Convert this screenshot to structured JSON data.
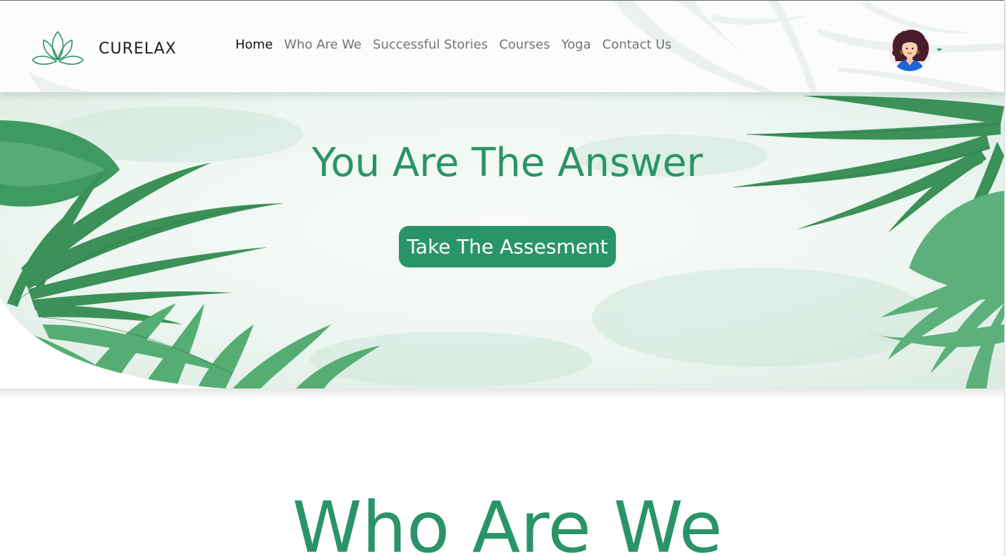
{
  "brand": {
    "name": "CURELAX",
    "accent_color": "#2a9469",
    "logo_icon": "lotus-icon"
  },
  "nav": {
    "links": [
      {
        "label": "Home",
        "active": true
      },
      {
        "label": "Who Are We",
        "active": false
      },
      {
        "label": "Successful Stories",
        "active": false
      },
      {
        "label": "Courses",
        "active": false
      },
      {
        "label": "Yoga",
        "active": false
      },
      {
        "label": "Contact Us",
        "active": false
      }
    ]
  },
  "profile": {
    "avatar_icon": "user-avatar-icon",
    "menu_icon": "caret-down-icon"
  },
  "hero": {
    "title": "You Are The Answer",
    "cta_label": "Take The Assesment",
    "decoration": "palm-leaves-illustration"
  },
  "about": {
    "title": "Who Are We"
  }
}
